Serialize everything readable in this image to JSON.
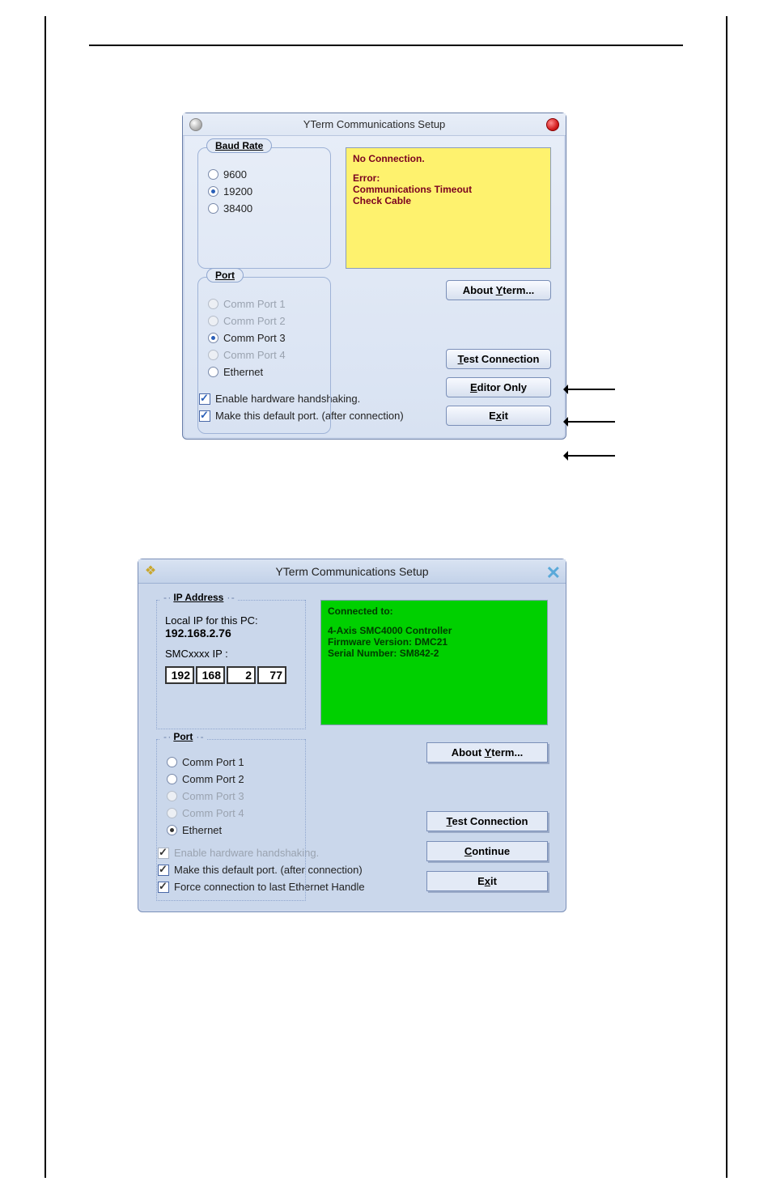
{
  "dialog1": {
    "title": "YTerm Communications Setup",
    "baud": {
      "legend": "Baud Rate",
      "options": [
        "9600",
        "19200",
        "38400"
      ],
      "selected": "19200"
    },
    "status": {
      "line1": "No Connection.",
      "line2": "Error:",
      "line3": "Communications Timeout",
      "line4": "Check Cable"
    },
    "port": {
      "legend": "Port",
      "options": [
        {
          "label": "Comm Port 1",
          "disabled": true,
          "selected": false
        },
        {
          "label": "Comm Port 2",
          "disabled": true,
          "selected": false
        },
        {
          "label": "Comm Port 3",
          "disabled": false,
          "selected": true
        },
        {
          "label": "Comm Port 4",
          "disabled": true,
          "selected": false
        },
        {
          "label": "Ethernet",
          "disabled": false,
          "selected": false
        }
      ]
    },
    "buttons": {
      "about_pre": "About ",
      "about_u": "Y",
      "about_post": "term...",
      "test_u": "T",
      "test_post": "est Connection",
      "editor_u": "E",
      "editor_post": "ditor Only",
      "exit_pre": "E",
      "exit_u": "x",
      "exit_post": "it"
    },
    "checks": {
      "hw": "Enable hardware handshaking.",
      "default": "Make this default port. (after connection)"
    }
  },
  "dialog2": {
    "title": "YTerm Communications Setup",
    "ip": {
      "legend": "IP Address",
      "local_label": "Local IP for this PC:",
      "local_value": "192.168.2.76",
      "smc_label": "SMCxxxx IP :",
      "octets": [
        "192",
        "168",
        "2",
        "77"
      ]
    },
    "status": {
      "line1": "Connected to:",
      "line2": "4-Axis SMC4000 Controller",
      "line3": "Firmware Version: DMC21",
      "line4": "Serial Number: SM842-2"
    },
    "port": {
      "legend": "Port",
      "options": [
        {
          "label": "Comm Port 1",
          "disabled": false,
          "selected": false
        },
        {
          "label": "Comm Port 2",
          "disabled": false,
          "selected": false
        },
        {
          "label": "Comm Port 3",
          "disabled": true,
          "selected": false
        },
        {
          "label": "Comm Port 4",
          "disabled": true,
          "selected": false
        },
        {
          "label": "Ethernet",
          "disabled": false,
          "selected": true
        }
      ]
    },
    "buttons": {
      "about_pre": "About ",
      "about_u": "Y",
      "about_post": "term...",
      "test_u": "T",
      "test_post": "est Connection",
      "continue_u": "C",
      "continue_post": "ontinue",
      "exit_pre": "E",
      "exit_u": "x",
      "exit_post": "it"
    },
    "checks": {
      "hw": "Enable hardware handshaking.",
      "default": "Make this default port. (after connection)",
      "force": "Force connection to last Ethernet Handle"
    }
  }
}
